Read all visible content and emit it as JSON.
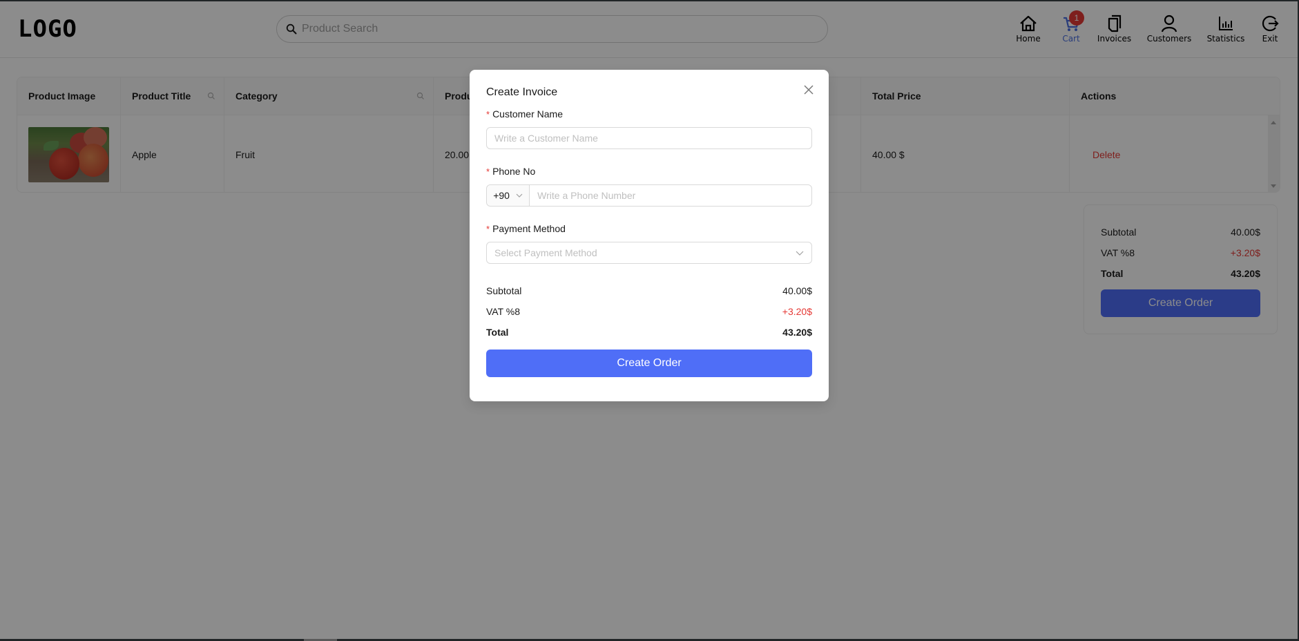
{
  "header": {
    "logo": "LOGO",
    "search_placeholder": "Product Search",
    "nav": [
      {
        "label": "Home",
        "icon": "home-icon",
        "active": false
      },
      {
        "label": "Cart",
        "icon": "cart-icon",
        "active": true,
        "badge": "1"
      },
      {
        "label": "Invoices",
        "icon": "invoices-icon",
        "active": false
      },
      {
        "label": "Customers",
        "icon": "customers-icon",
        "active": false
      },
      {
        "label": "Statistics",
        "icon": "statistics-icon",
        "active": false
      },
      {
        "label": "Exit",
        "icon": "exit-icon",
        "active": false
      }
    ]
  },
  "table": {
    "columns": [
      "Product Image",
      "Product Title",
      "Category",
      "Produ",
      "",
      "Total Price",
      "Actions"
    ],
    "rows": [
      {
        "image": "apple-image",
        "title": "Apple",
        "category": "Fruit",
        "price": "20.00",
        "total": "40.00 $",
        "action": "Delete"
      }
    ]
  },
  "summary": {
    "subtotal_label": "Subtotal",
    "subtotal_value": "40.00$",
    "vat_label": "VAT %8",
    "vat_value": "+3.20$",
    "total_label": "Total",
    "total_value": "43.20$",
    "button": "Create Order"
  },
  "modal": {
    "title": "Create Invoice",
    "customer_label": "Customer Name",
    "customer_placeholder": "Write a Customer Name",
    "customer_value": "",
    "phone_label": "Phone No",
    "phone_prefix": "+90",
    "phone_placeholder": "Write a Phone Number",
    "phone_value": "",
    "payment_label": "Payment Method",
    "payment_placeholder": "Select Payment Method",
    "required_mark": "*",
    "subtotal_label": "Subtotal",
    "subtotal_value": "40.00$",
    "vat_label": "VAT %8",
    "vat_value": "+3.20$",
    "total_label": "Total",
    "total_value": "43.20$",
    "button": "Create Order"
  },
  "colors": {
    "accent": "#4f6ef7",
    "danger": "#e53935",
    "active_nav": "#4a6ee0"
  }
}
